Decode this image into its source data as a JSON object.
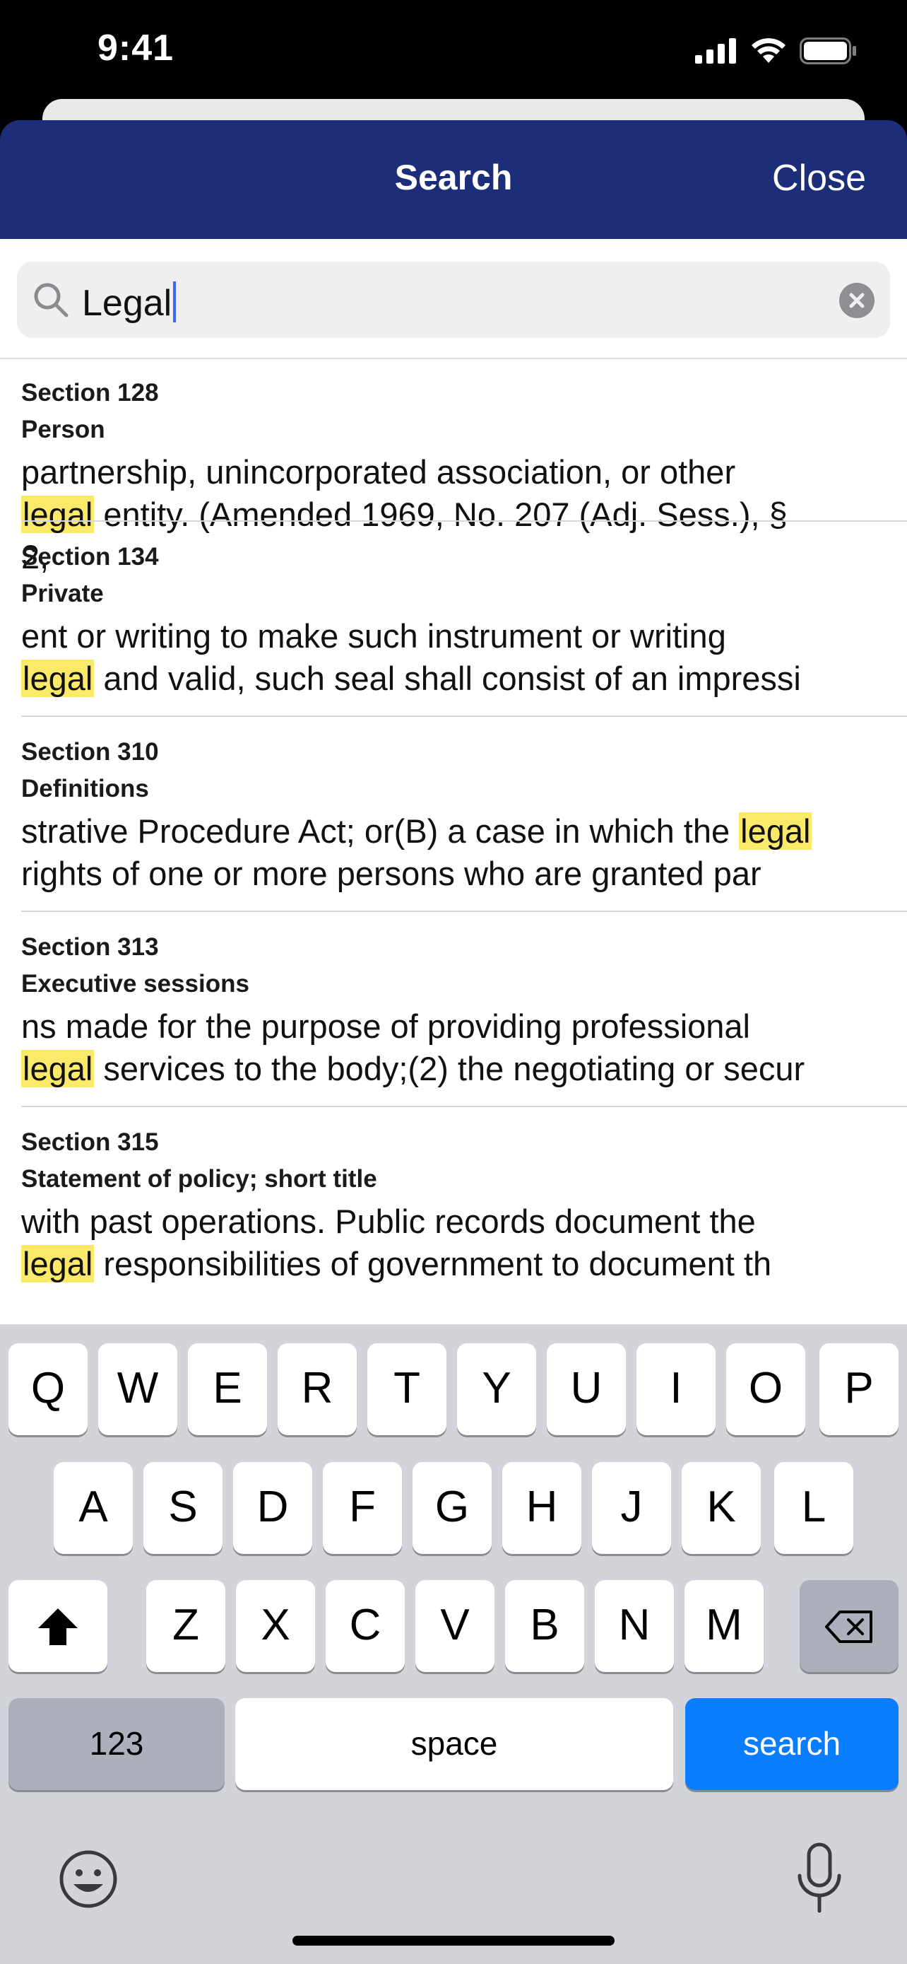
{
  "status_bar": {
    "time": "9:41"
  },
  "nav": {
    "title": "Search",
    "close_label": "Close"
  },
  "search": {
    "value": "Legal"
  },
  "results": [
    {
      "section": "Section 128",
      "heading": "Person",
      "pre": "partnership, unincorporated association, or other\n",
      "match": "legal",
      "post": " entity. (Amended 1969, No. 207 (Adj. Sess.), §\n2,"
    },
    {
      "section": "Section 134",
      "heading": "Private",
      "pre": "ent or writing to make such instrument or writing\n",
      "match": "legal",
      "post": " and valid, such seal shall consist of an impressi"
    },
    {
      "section": "Section 310",
      "heading": "Definitions",
      "pre": "strative Procedure Act; or(B) a case in which the ",
      "match": "legal",
      "post": "\nrights of one or more persons who are granted par"
    },
    {
      "section": "Section 313",
      "heading": "Executive sessions",
      "pre": "ns made for the purpose of providing professional\n",
      "match": "legal",
      "post": " services to the body;(2) the negotiating or secur"
    },
    {
      "section": "Section 315",
      "heading": "Statement of policy; short title",
      "pre": "with past operations. Public records document the\n",
      "match": "legal",
      "post": " responsibilities of government to document th"
    }
  ],
  "keyboard": {
    "row1": [
      "Q",
      "W",
      "E",
      "R",
      "T",
      "Y",
      "U",
      "I",
      "O",
      "P"
    ],
    "row2": [
      "A",
      "S",
      "D",
      "F",
      "G",
      "H",
      "J",
      "K",
      "L"
    ],
    "row3": [
      "Z",
      "X",
      "C",
      "V",
      "B",
      "N",
      "M"
    ],
    "numbers_label": "123",
    "space_label": "space",
    "action_label": "search"
  }
}
